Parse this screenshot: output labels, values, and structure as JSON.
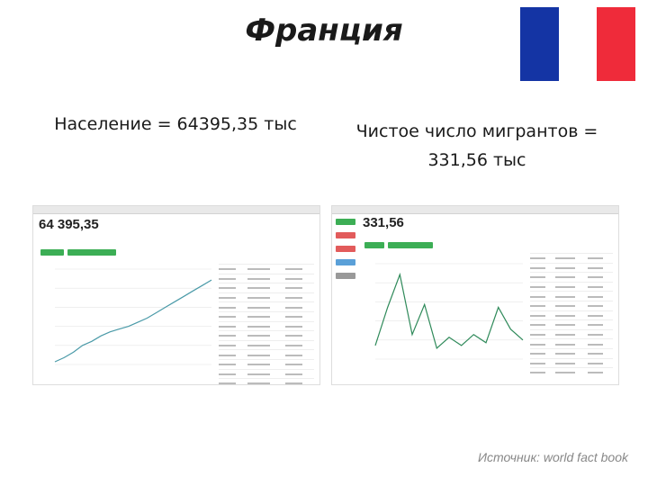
{
  "slide": {
    "title": "Франция",
    "population_label": "Население = 64395,35 тыс",
    "migrants_label": "Чистое число мигрантов = 331,56 тыс",
    "source": "Источник: world fact book",
    "flag_colors": [
      "#1434a4",
      "#ffffff",
      "#ef2b3a"
    ]
  },
  "left_screenshot": {
    "big_value": "64 395,35",
    "accent": "#3cae55"
  },
  "right_screenshot": {
    "big_value": "331,56",
    "accent": "#3cae55",
    "chart_data": {
      "type": "line",
      "series": [
        {
          "values": [
            10,
            38,
            62,
            18,
            40,
            8,
            16,
            10,
            18,
            12,
            38,
            22,
            14
          ]
        }
      ],
      "ylim": [
        0,
        70
      ]
    }
  },
  "left_chart_data": {
    "type": "line",
    "series": [
      {
        "values": [
          2,
          5,
          9,
          14,
          17,
          21,
          24,
          26,
          28,
          31,
          34,
          38,
          42,
          46,
          50,
          54,
          58,
          62
        ]
      }
    ],
    "ylim": [
      0,
      70
    ]
  }
}
